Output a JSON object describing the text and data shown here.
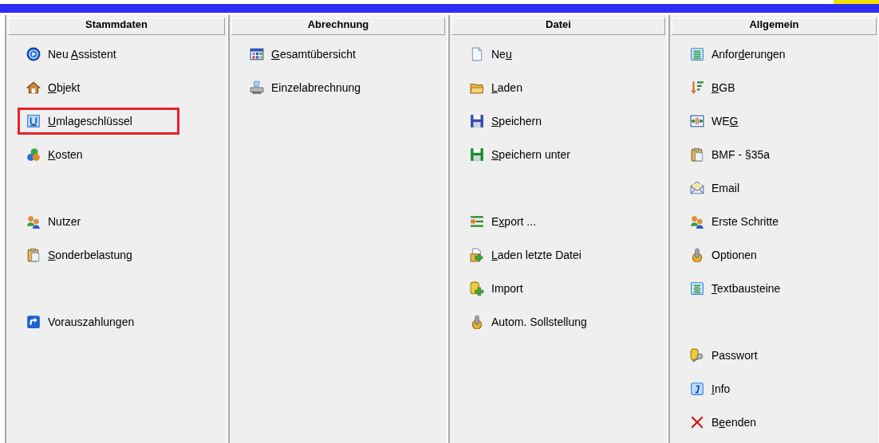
{
  "columns": [
    {
      "title": "Stammdaten",
      "groups": [
        [
          {
            "label": [
              {
                "text": "Neu ",
                "underlined": false
              },
              {
                "text": "A",
                "underlined": true
              },
              {
                "text": "ssistent",
                "underlined": false
              }
            ],
            "highlighted": false
          },
          {
            "label": [
              {
                "text": "O",
                "underlined": true
              },
              {
                "text": "bjekt",
                "underlined": false
              }
            ],
            "highlighted": false
          },
          {
            "label": [
              {
                "text": "U",
                "underlined": true
              },
              {
                "text": "mlageschlüssel",
                "underlined": false
              }
            ],
            "highlighted": true
          },
          {
            "label": [
              {
                "text": "K",
                "underlined": true
              },
              {
                "text": "osten",
                "underlined": false
              }
            ],
            "highlighted": false
          }
        ],
        [
          {
            "label": [
              {
                "text": "Nutzer",
                "underlined": false
              }
            ],
            "highlighted": false
          },
          {
            "label": [
              {
                "text": "S",
                "underlined": true
              },
              {
                "text": "onderbelastung",
                "underlined": false
              }
            ],
            "highlighted": false
          }
        ],
        [
          {
            "label": [
              {
                "text": "Vorauszahlungen",
                "underlined": false
              }
            ],
            "highlighted": false
          }
        ]
      ]
    },
    {
      "title": "Abrechnung",
      "groups": [
        [
          {
            "label": [
              {
                "text": "G",
                "underlined": true
              },
              {
                "text": "esamtübersicht",
                "underlined": false
              }
            ],
            "highlighted": false
          },
          {
            "label": [
              {
                "text": "Einzelabrechnung",
                "underlined": false
              }
            ],
            "highlighted": false
          }
        ]
      ]
    },
    {
      "title": "Datei",
      "groups": [
        [
          {
            "label": [
              {
                "text": "Ne",
                "underlined": false
              },
              {
                "text": "u",
                "underlined": true
              }
            ],
            "highlighted": false
          },
          {
            "label": [
              {
                "text": "L",
                "underlined": true
              },
              {
                "text": "aden",
                "underlined": false
              }
            ],
            "highlighted": false
          },
          {
            "label": [
              {
                "text": "S",
                "underlined": true
              },
              {
                "text": "peichern",
                "underlined": false
              }
            ],
            "highlighted": false
          },
          {
            "label": [
              {
                "text": "S",
                "underlined": true
              },
              {
                "text": "peichern unter",
                "underlined": false
              }
            ],
            "highlighted": false
          }
        ],
        [
          {
            "label": [
              {
                "text": "E",
                "underlined": false
              },
              {
                "text": "x",
                "underlined": true
              },
              {
                "text": "port ...",
                "underlined": false
              }
            ],
            "highlighted": false
          },
          {
            "label": [
              {
                "text": "L",
                "underlined": true
              },
              {
                "text": "aden letzte Datei",
                "underlined": false
              }
            ],
            "highlighted": false
          },
          {
            "label": [
              {
                "text": "Import",
                "underlined": false
              }
            ],
            "highlighted": false
          },
          {
            "label": [
              {
                "text": "Autom. Sollstellung",
                "underlined": false
              }
            ],
            "highlighted": false
          }
        ]
      ]
    },
    {
      "title": "Allgemein",
      "groups": [
        [
          {
            "label": [
              {
                "text": "Anfor",
                "underlined": false
              },
              {
                "text": "d",
                "underlined": true
              },
              {
                "text": "erungen",
                "underlined": false
              }
            ],
            "highlighted": false
          },
          {
            "label": [
              {
                "text": "B",
                "underlined": true
              },
              {
                "text": "GB",
                "underlined": false
              }
            ],
            "highlighted": false
          },
          {
            "label": [
              {
                "text": "WE",
                "underlined": false
              },
              {
                "text": "G",
                "underlined": true
              }
            ],
            "highlighted": false
          },
          {
            "label": [
              {
                "text": "BMF - §35a",
                "underlined": false
              }
            ],
            "highlighted": false
          },
          {
            "label": [
              {
                "text": "Email",
                "underlined": false
              }
            ],
            "highlighted": false
          },
          {
            "label": [
              {
                "text": "Erste Schritte",
                "underlined": false
              }
            ],
            "highlighted": false
          },
          {
            "label": [
              {
                "text": "Optionen",
                "underlined": false
              }
            ],
            "highlighted": false
          },
          {
            "label": [
              {
                "text": "T",
                "underlined": true
              },
              {
                "text": "extbausteine",
                "underlined": false
              }
            ],
            "highlighted": false
          }
        ],
        [
          {
            "label": [
              {
                "text": "Passwort",
                "underlined": false
              }
            ],
            "highlighted": false
          },
          {
            "label": [
              {
                "text": "I",
                "underlined": true
              },
              {
                "text": "nfo",
                "underlined": false
              }
            ],
            "highlighted": false
          },
          {
            "label": [
              {
                "text": "B",
                "underlined": false
              },
              {
                "text": "e",
                "underlined": true
              },
              {
                "text": "enden",
                "underlined": false
              }
            ],
            "highlighted": false
          }
        ]
      ]
    }
  ]
}
